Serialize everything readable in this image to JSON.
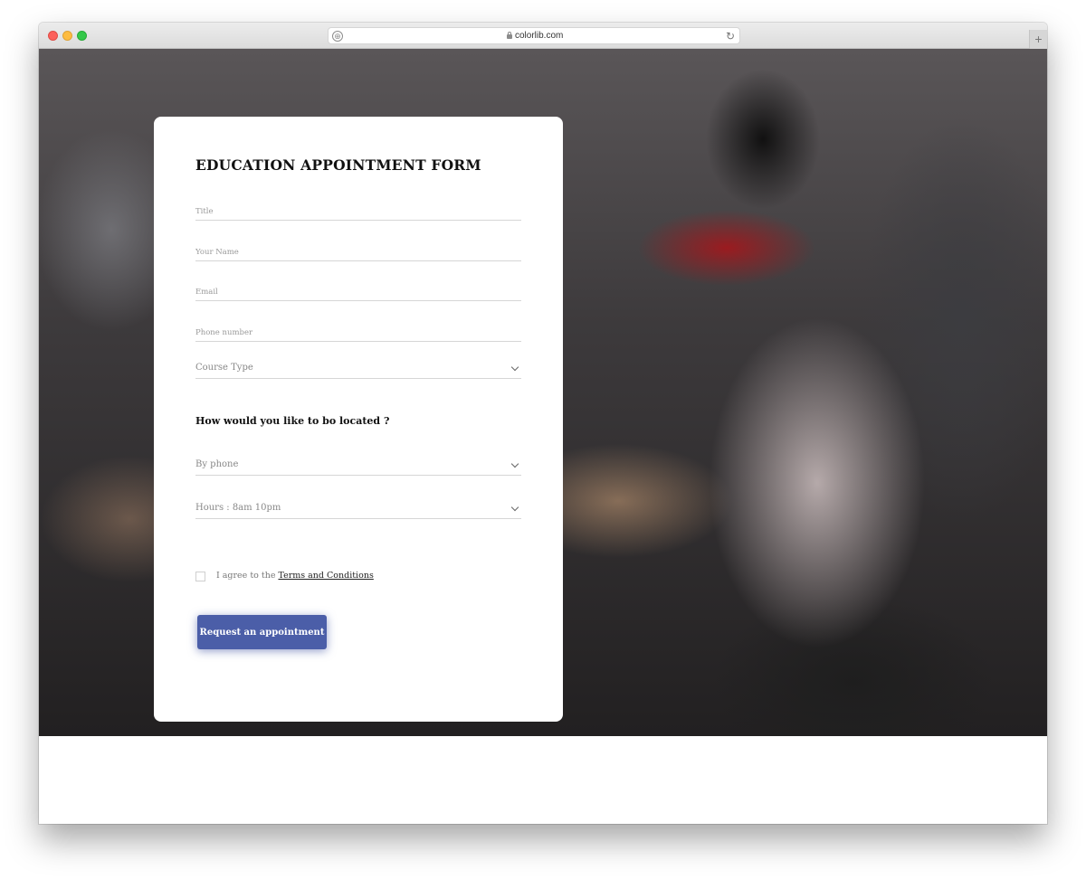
{
  "browser": {
    "url": "colorlib.com",
    "new_tab_symbol": "+",
    "reload_symbol": "↻",
    "shield_symbol": "⊕"
  },
  "form": {
    "title": "EDUCATION APPOINTMENT FORM",
    "fields": {
      "title_placeholder": "Title",
      "name_placeholder": "Your Name",
      "email_placeholder": "Email",
      "phone_placeholder": "Phone number"
    },
    "course_type": "Course Type",
    "question": "How would you like to bo located ?",
    "contact_method": "By phone",
    "hours": "Hours : 8am 10pm",
    "agree_prefix": "I agree to the ",
    "terms_link": "Terms and Conditions",
    "agree_checked": false,
    "submit_label": "Request an appointment"
  },
  "colors": {
    "accent": "#4b5ea8",
    "card_background": "#ffffff"
  }
}
